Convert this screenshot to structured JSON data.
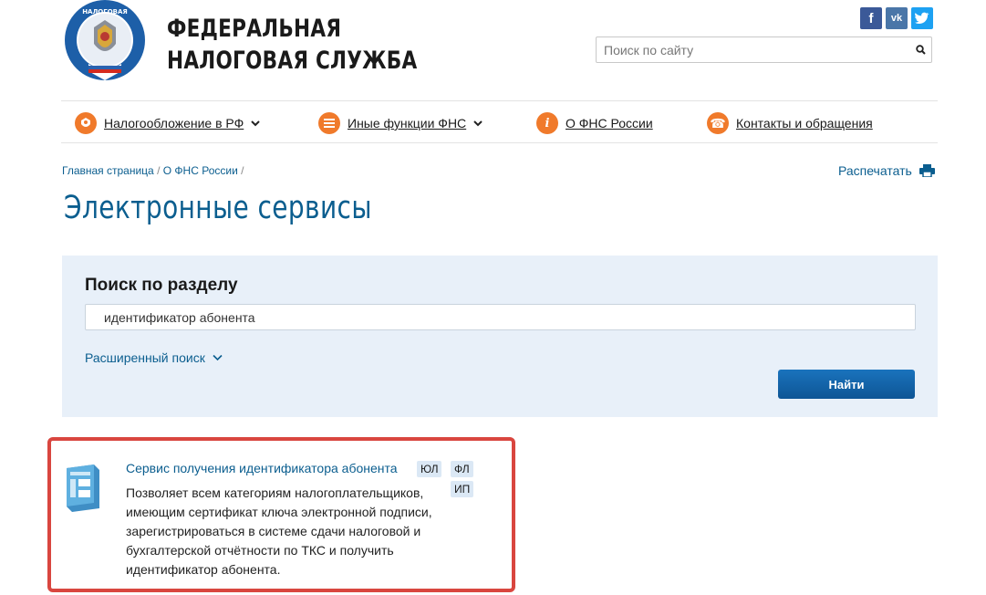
{
  "header": {
    "title_line1": "ФЕДЕРАЛЬНАЯ",
    "title_line2": "НАЛОГОВАЯ СЛУЖБА",
    "logo_icon": "fns-emblem-icon",
    "social": [
      "facebook-icon",
      "vk-icon",
      "twitter-icon"
    ],
    "search_placeholder": "Поиск по сайту"
  },
  "nav": {
    "items": [
      {
        "label": "Налогообложение в РФ",
        "icon": "emblem-icon",
        "has_dropdown": true
      },
      {
        "label": "Иные функции ФНС",
        "icon": "menu-icon",
        "has_dropdown": true
      },
      {
        "label": "О ФНС России",
        "icon": "info-icon",
        "has_dropdown": false
      },
      {
        "label": "Контакты и обращения",
        "icon": "phone-icon",
        "has_dropdown": false
      }
    ]
  },
  "breadcrumb": {
    "items": [
      "Главная страница",
      "О ФНС России"
    ],
    "separator": "/"
  },
  "print_label": "Распечатать",
  "page_title": "Электронные сервисы",
  "search_panel": {
    "title": "Поиск по разделу",
    "input_value": "идентификатор абонента",
    "advanced_label": "Расширенный поиск",
    "button_label": "Найти"
  },
  "result": {
    "link": "Сервис получения идентификатора абонента",
    "tags": [
      "ЮЛ",
      "ФЛ",
      "ИП"
    ],
    "description": "Позволяет всем категориям налогоплательщиков, имеющим сертификат ключа электронной подписи, зарегистрироваться в системе сдачи налоговой и бухгалтерской отчётности по ТКС и получить идентификатор абонента."
  },
  "colors": {
    "accent": "#0b5e8f",
    "nav_icon": "#f07a2b",
    "panel_bg": "#e8f0f9",
    "highlight_border": "#d9463f",
    "button": "#1464a8"
  }
}
